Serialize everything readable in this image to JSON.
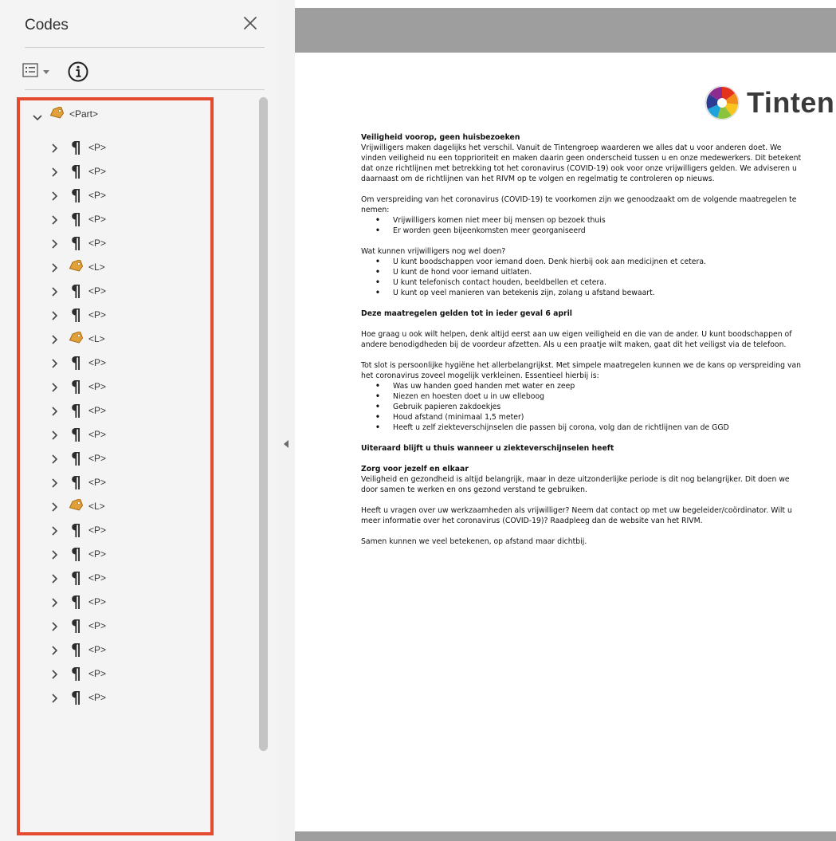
{
  "panel": {
    "title": "Codes",
    "icons": {
      "close": "close-icon",
      "options": "list-options-icon",
      "dropdown": "caret-down-icon",
      "info": "info-icon"
    },
    "tree": [
      {
        "label": "<Part>",
        "icon": "tag-icon",
        "expanded": true
      },
      {
        "label": "<P>",
        "icon": "paragraph-icon"
      },
      {
        "label": "<P>",
        "icon": "paragraph-icon"
      },
      {
        "label": "<P>",
        "icon": "paragraph-icon"
      },
      {
        "label": "<P>",
        "icon": "paragraph-icon"
      },
      {
        "label": "<P>",
        "icon": "paragraph-icon"
      },
      {
        "label": "<L>",
        "icon": "tag-icon"
      },
      {
        "label": "<P>",
        "icon": "paragraph-icon"
      },
      {
        "label": "<P>",
        "icon": "paragraph-icon"
      },
      {
        "label": "<L>",
        "icon": "tag-icon"
      },
      {
        "label": "<P>",
        "icon": "paragraph-icon"
      },
      {
        "label": "<P>",
        "icon": "paragraph-icon"
      },
      {
        "label": "<P>",
        "icon": "paragraph-icon"
      },
      {
        "label": "<P>",
        "icon": "paragraph-icon"
      },
      {
        "label": "<P>",
        "icon": "paragraph-icon"
      },
      {
        "label": "<P>",
        "icon": "paragraph-icon"
      },
      {
        "label": "<L>",
        "icon": "tag-icon"
      },
      {
        "label": "<P>",
        "icon": "paragraph-icon"
      },
      {
        "label": "<P>",
        "icon": "paragraph-icon"
      },
      {
        "label": "<P>",
        "icon": "paragraph-icon"
      },
      {
        "label": "<P>",
        "icon": "paragraph-icon"
      },
      {
        "label": "<P>",
        "icon": "paragraph-icon"
      },
      {
        "label": "<P>",
        "icon": "paragraph-icon"
      },
      {
        "label": "<P>",
        "icon": "paragraph-icon"
      },
      {
        "label": "<P>",
        "icon": "paragraph-icon"
      }
    ]
  },
  "colors": {
    "highlight_border": "#e34a2f",
    "toolbar_gray": "#9e9e9e"
  },
  "document": {
    "logo_text": "Tinten",
    "blocks": [
      {
        "type": "p",
        "heading": "Veiligheid voorop, geen huisbezoeken",
        "text": "Vrijwilligers maken dagelijks het verschil. Vanuit de Tintengroep waarderen we alles dat u voor anderen doet. We vinden veiligheid nu een topprioriteit en maken daarin geen onderscheid tussen u en onze medewerkers. Dit betekent dat onze richtlijnen met betrekking tot het coronavirus (COVID-19) ook voor onze vrijwilligers gelden. We adviseren u daarnaast om de richtlijnen van het RIVM op te volgen en regelmatig te controleren op nieuws."
      },
      {
        "type": "plist",
        "text": "Om verspreiding van het coronavirus (COVID-19) te voorkomen zijn we genoodzaakt om de volgende maatregelen te nemen:",
        "items": [
          "Vrijwilligers komen niet meer bij mensen op bezoek thuis",
          "Er worden geen bijeenkomsten meer georganiseerd"
        ]
      },
      {
        "type": "plist",
        "text": "Wat kunnen vrijwilligers nog wel doen?",
        "items": [
          "U kunt boodschappen voor iemand doen. Denk hierbij ook aan medicijnen et cetera.",
          "U kunt de hond voor iemand uitlaten.",
          "U kunt telefonisch contact houden, beeldbellen et cetera.",
          "U kunt op veel manieren van betekenis zijn, zolang u afstand bewaart."
        ]
      },
      {
        "type": "bold",
        "text": "Deze maatregelen gelden tot in ieder geval 6 april"
      },
      {
        "type": "p",
        "text": "Hoe graag u ook wilt helpen, denk altijd eerst aan uw eigen veiligheid en die van de ander. U kunt boodschappen of andere benodigdheden bij de voordeur afzetten. Als u een praatje wilt maken, gaat dit het veiligst via de telefoon."
      },
      {
        "type": "plist",
        "text": "Tot slot is persoonlijke hygiëne het allerbelangrijkst. Met simpele maatregelen kunnen we de kans op verspreiding van het coronavirus zoveel mogelijk verkleinen. Essentieel hierbij is:",
        "items": [
          "Was uw handen goed handen met water en zeep",
          "Niezen en hoesten doet u in uw elleboog",
          "Gebruik papieren zakdoekjes",
          "Houd afstand (minimaal 1,5 meter)",
          "Heeft u zelf ziekteverschijnselen die passen bij corona, volg dan de richtlijnen van de GGD"
        ]
      },
      {
        "type": "bold",
        "text": "Uiteraard blijft u thuis wanneer u ziekteverschijnselen heeft"
      },
      {
        "type": "p",
        "heading": "Zorg voor jezelf en elkaar",
        "text": "Veiligheid en gezondheid is altijd belangrijk, maar in deze uitzonderlijke periode is dit nog belangrijker. Dit doen we door samen te werken en ons gezond verstand te gebruiken."
      },
      {
        "type": "p",
        "text": "Heeft u vragen over uw werkzaamheden als vrijwilliger? Neem dat contact op met uw begeleider/coördinator. Wilt u meer informatie over het coronavirus (COVID-19)? Raadpleeg dan de website van het RIVM."
      },
      {
        "type": "p",
        "text": "Samen kunnen we veel betekenen, op afstand maar dichtbij."
      }
    ]
  }
}
